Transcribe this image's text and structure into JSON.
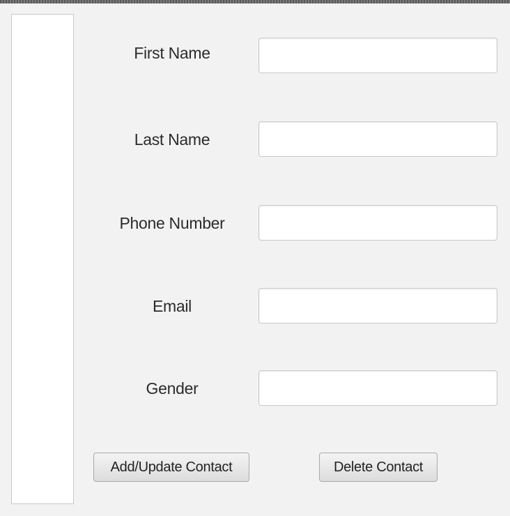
{
  "form": {
    "fields": [
      {
        "label": "First Name",
        "value": "",
        "placeholder": ""
      },
      {
        "label": "Last Name",
        "value": "",
        "placeholder": ""
      },
      {
        "label": "Phone Number",
        "value": "",
        "placeholder": ""
      },
      {
        "label": "Email",
        "value": "",
        "placeholder": ""
      },
      {
        "label": "Gender",
        "value": "",
        "placeholder": ""
      }
    ]
  },
  "actions": {
    "add_update_label": "Add/Update Contact",
    "delete_label": "Delete Contact"
  },
  "contact_list": {
    "items": []
  }
}
